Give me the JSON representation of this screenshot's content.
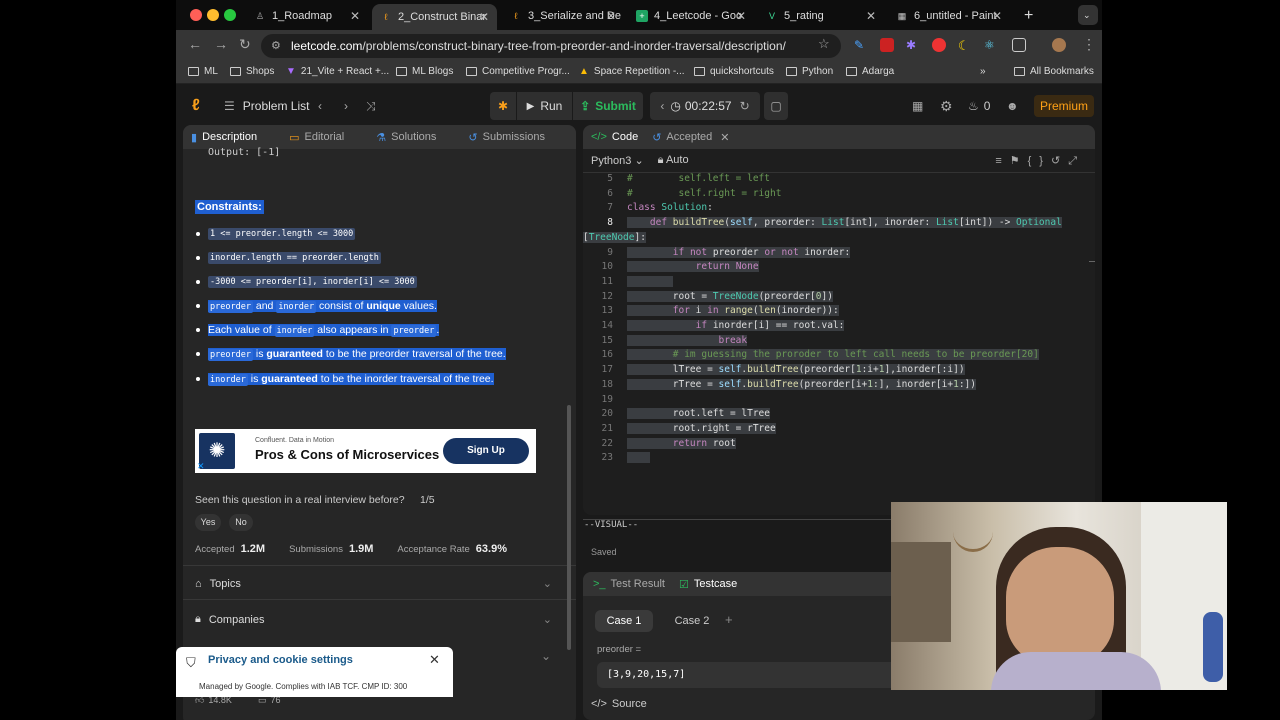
{
  "browser": {
    "tabs": [
      "1_Roadmap",
      "2_Construct Binar",
      "3_Serialize and De",
      "4_Leetcode - Goo",
      "5_rating",
      "6_untitled - Paint"
    ],
    "url_domain": "leetcode.com",
    "url_path": "/problems/construct-binary-tree-from-preorder-and-inorder-traversal/description/",
    "bookmarks": [
      "ML",
      "Shops",
      "21_Vite + React +...",
      "ML Blogs",
      "Competitive Progr...",
      "Space Repetition -...",
      "quickshortcuts",
      "Python",
      "Adarga"
    ],
    "all_bookmarks": "All Bookmarks"
  },
  "lc": {
    "problem_list": "Problem List",
    "run": "Run",
    "submit": "Submit",
    "timer": "00:22:57",
    "fire_count": "0",
    "premium": "Premium"
  },
  "left": {
    "tabs": [
      "Description",
      "Editorial",
      "Solutions",
      "Submissions"
    ],
    "output_line": "Output: [-1]",
    "constraints_title": "Constraints:",
    "c1": "1 <= preorder.length <= 3000",
    "c2": "inorder.length == preorder.length",
    "c3": "-3000 <= preorder[i], inorder[i] <= 3000",
    "c4a": "preorder",
    "c4b": " and ",
    "c4c": "inorder",
    "c4d": " consist of ",
    "c4e": "unique",
    "c4f": " values.",
    "c5a": "Each value of ",
    "c5b": "inorder",
    "c5c": " also appears in ",
    "c5d": "preorder",
    "c6a": "preorder",
    "c6b": " is ",
    "c6c": "guaranteed",
    "c6d": " to be the preorder traversal of the tree.",
    "c7a": "inorder",
    "c7b": " is ",
    "c7c": "guaranteed",
    "c7d": " to be the inorder traversal of the tree.",
    "ad_small": "Confluent. Data in Motion",
    "ad_title": "Pros & Cons of Microservices",
    "ad_btn": "Sign Up",
    "interview_q": "Seen this question in a real interview before?",
    "interview_page": "1/5",
    "yes": "Yes",
    "no": "No",
    "accepted_label": "Accepted",
    "accepted_val": "1.2M",
    "subs_label": "Submissions",
    "subs_val": "1.9M",
    "rate_label": "Acceptance Rate",
    "rate_val": "63.9%",
    "topics": "Topics",
    "companies": "Companies",
    "likes": "14.8K",
    "comments": "76"
  },
  "right": {
    "tabs": [
      "Code",
      "Accepted"
    ],
    "lang": "Python3",
    "auto": "Auto",
    "vim_mode": "--VISUAL--",
    "saved": "Saved",
    "code": [
      {
        "n": "5",
        "t": "#        self.left = left"
      },
      {
        "n": "6",
        "t": "#        self.right = right"
      },
      {
        "n": "7",
        "t": "class Solution:"
      },
      {
        "n": "8",
        "t": "    def buildTree(self, preorder: List[int], inorder: List[int]) -> Optional"
      },
      {
        "n": "",
        "t": "[TreeNode]:"
      },
      {
        "n": "9",
        "t": "        if not preorder or not inorder:"
      },
      {
        "n": "10",
        "t": "            return None"
      },
      {
        "n": "11",
        "t": "        "
      },
      {
        "n": "12",
        "t": "        root = TreeNode(preorder[0])"
      },
      {
        "n": "13",
        "t": "        for i in range(len(inorder)):"
      },
      {
        "n": "14",
        "t": "            if inorder[i] == root.val:"
      },
      {
        "n": "15",
        "t": "                break"
      },
      {
        "n": "16",
        "t": "        # im guessing the proroder to left call needs to be preorder[20]"
      },
      {
        "n": "17",
        "t": "        lTree = self.buildTree(preorder[1:i+1],inorder[:i])"
      },
      {
        "n": "18",
        "t": "        rTree = self.buildTree(preorder[i+1:], inorder[i+1:])"
      },
      {
        "n": "19",
        "t": ""
      },
      {
        "n": "20",
        "t": "        root.left = lTree"
      },
      {
        "n": "21",
        "t": "        root.right = rTree"
      },
      {
        "n": "22",
        "t": "        return root"
      },
      {
        "n": "23",
        "t": "    "
      }
    ]
  },
  "bottom": {
    "tabs": [
      "Test Result",
      "Testcase"
    ],
    "cases": [
      "Case 1",
      "Case 2"
    ],
    "var_label": "preorder =",
    "var_value": "[3,9,20,15,7]",
    "source": "Source"
  },
  "cookie": {
    "title": "Privacy and cookie settings",
    "sub": "Managed by Google. Complies with IAB TCF. CMP ID: 300"
  }
}
